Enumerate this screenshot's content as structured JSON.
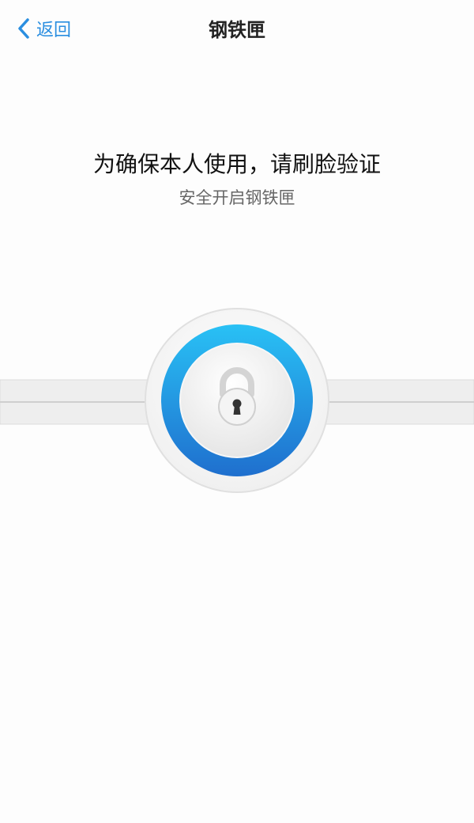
{
  "nav": {
    "back_label": "返回",
    "title": "钢铁匣"
  },
  "main": {
    "headline": "为确保本人使用，请刷脸验证",
    "subline": "安全开启钢铁匣"
  },
  "colors": {
    "accent": "#2a8ee0",
    "ring_top": "#29c1f5",
    "ring_bottom": "#1f6fce"
  },
  "icons": {
    "back": "chevron-left-icon",
    "lock": "padlock-icon"
  }
}
